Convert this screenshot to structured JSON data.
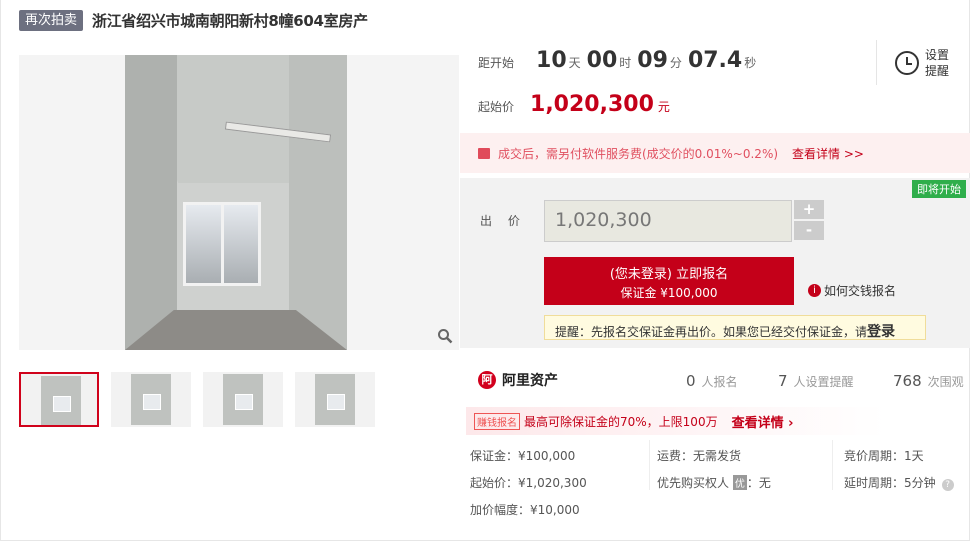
{
  "header": {
    "badge": "再次拍卖",
    "title": "浙江省绍兴市城南朝阳新村8幢604室房产"
  },
  "countdown": {
    "label": "距开始",
    "days": "10",
    "days_unit": "天",
    "hours": "00",
    "hours_unit": "时",
    "minutes": "09",
    "minutes_unit": "分",
    "seconds": "07.4",
    "seconds_unit": "秒"
  },
  "remind": {
    "label": "设置提醒"
  },
  "start_price": {
    "label": "起始价",
    "value": "1,020,300",
    "unit": "元"
  },
  "fee_notice": {
    "text": "成交后，需另付软件服务费(成交价的0.01%~0.2%)",
    "link": "查看详情 >>"
  },
  "bid": {
    "status_badge": "即将开始",
    "label": "出 价",
    "input_value": "1,020,300",
    "plus": "+",
    "minus": "-",
    "register_line1": "(您未登录) 立即报名",
    "register_line2": "保证金 ¥100,000",
    "how_to": "如何交钱报名",
    "tip_text": "提醒：先报名交保证金再出价。如果您已经交付保证金，请",
    "tip_login": "登录"
  },
  "brand": {
    "logo_char": "阿",
    "name": "阿里资产"
  },
  "stats": [
    {
      "num": "0",
      "unit": "人报名"
    },
    {
      "num": "7",
      "unit": "人设置提醒"
    },
    {
      "num": "768",
      "unit": "次围观"
    }
  ],
  "earn": {
    "tag": "赚钱报名",
    "text": "最高可除保证金的70%，上限100万",
    "link": "查看详情 ›"
  },
  "info": {
    "deposit": "保证金：¥100,000",
    "start": "起始价：¥1,020,300",
    "increment": "加价幅度：¥10,000",
    "shipping": "运费：无需发货",
    "priority": "优先购买权人",
    "priority_tag": "优",
    "priority_val": "：无",
    "cycle": "竞价周期：1天",
    "delay": "延时周期：5分钟",
    "delay_help": "?"
  },
  "zoom_icon": "magnifier-icon"
}
